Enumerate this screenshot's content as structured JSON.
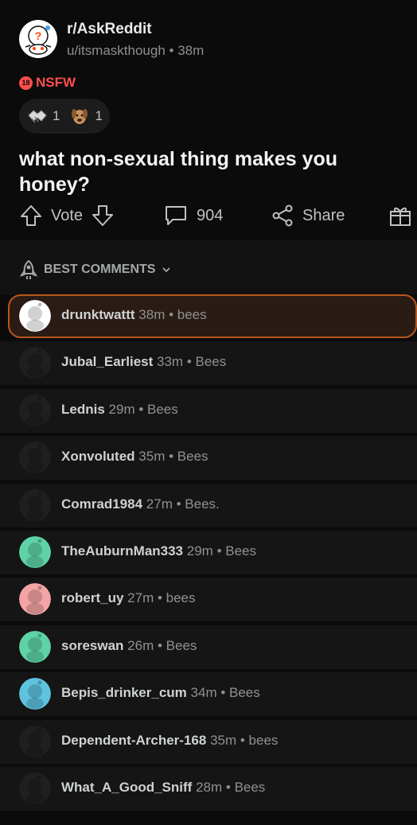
{
  "post": {
    "subreddit": "r/AskReddit",
    "meta": "u/itsmaskthough • 38m",
    "nsfw_badge": "18",
    "nsfw_label": "NSFW",
    "awards": [
      {
        "icon": "handshake-award-icon",
        "count": "1"
      },
      {
        "icon": "dog-award-icon",
        "count": "1"
      }
    ],
    "title": "what non-sexual thing makes you honey?"
  },
  "actions": {
    "vote_label": "Vote",
    "comments_count": "904",
    "share_label": "Share"
  },
  "sort": {
    "label": "BEST COMMENTS"
  },
  "comments": [
    {
      "user": "drunktwattt",
      "age": "38m",
      "body": "bees",
      "avatar_color": "#ffffff",
      "highlighted": true
    },
    {
      "user": "Jubal_Earliest",
      "age": "33m",
      "body": "Bees",
      "avatar_color": "#1f1f1f"
    },
    {
      "user": "Lednis",
      "age": "29m",
      "body": "Bees",
      "avatar_color": "#1f1f1f"
    },
    {
      "user": "Xonvoluted",
      "age": "35m",
      "body": "Bees",
      "avatar_color": "#1f1f1f"
    },
    {
      "user": "Comrad1984",
      "age": "27m",
      "body": "Bees.",
      "avatar_color": "#1f1f1f"
    },
    {
      "user": "TheAuburnMan333",
      "age": "29m",
      "body": "Bees",
      "avatar_color": "#5ed3a7"
    },
    {
      "user": "robert_uy",
      "age": "27m",
      "body": "bees",
      "avatar_color": "#f4a4a4"
    },
    {
      "user": "soreswan",
      "age": "26m",
      "body": "Bees",
      "avatar_color": "#5ed3a7"
    },
    {
      "user": "Bepis_drinker_cum",
      "age": "34m",
      "body": "Bees",
      "avatar_color": "#5fc3e0"
    },
    {
      "user": "Dependent-Archer-168",
      "age": "35m",
      "body": "bees",
      "avatar_color": "#1f1f1f"
    },
    {
      "user": "What_A_Good_Sniff",
      "age": "28m",
      "body": "Bees",
      "avatar_color": "#1f1f1f"
    }
  ]
}
